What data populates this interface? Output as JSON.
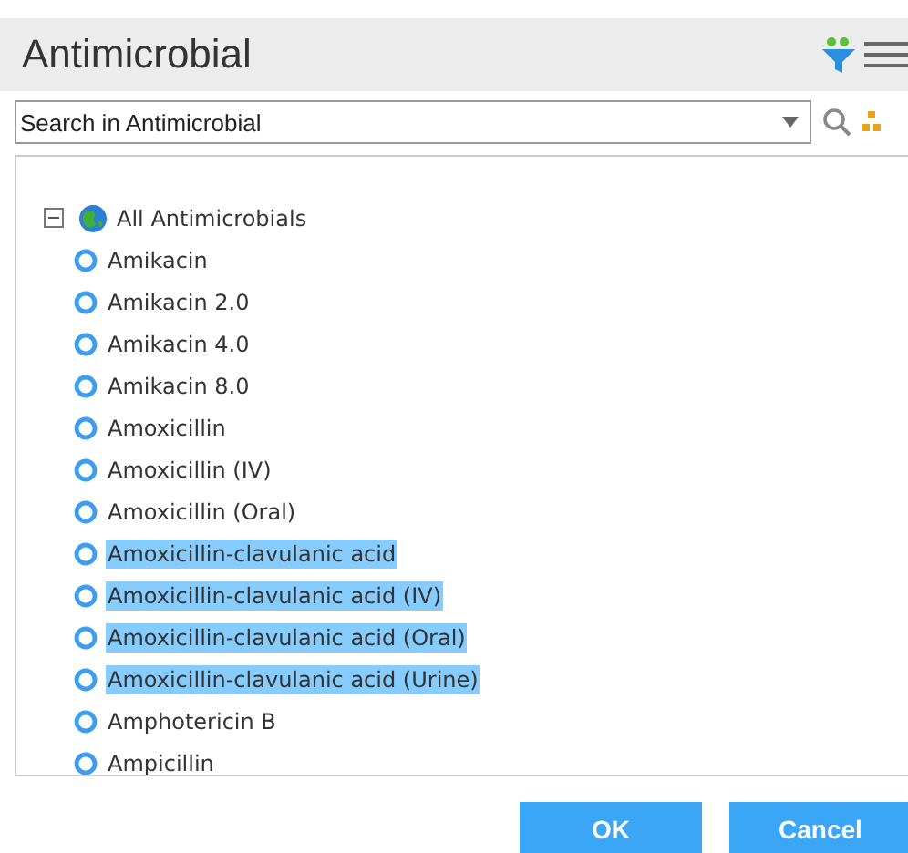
{
  "header": {
    "title": "Antimicrobial"
  },
  "search": {
    "placeholder": "Search in Antimicrobial"
  },
  "tree": {
    "label": "All Antimicrobials",
    "expanded": true,
    "children": [
      {
        "label": "Amikacin",
        "selected": false
      },
      {
        "label": "Amikacin 2.0",
        "selected": false
      },
      {
        "label": "Amikacin 4.0",
        "selected": false
      },
      {
        "label": "Amikacin 8.0",
        "selected": false
      },
      {
        "label": "Amoxicillin",
        "selected": false
      },
      {
        "label": "Amoxicillin (IV)",
        "selected": false
      },
      {
        "label": "Amoxicillin (Oral)",
        "selected": false
      },
      {
        "label": "Amoxicillin-clavulanic acid",
        "selected": true
      },
      {
        "label": "Amoxicillin-clavulanic acid (IV)",
        "selected": true
      },
      {
        "label": "Amoxicillin-clavulanic acid (Oral)",
        "selected": true
      },
      {
        "label": "Amoxicillin-clavulanic acid (Urine)",
        "selected": true
      },
      {
        "label": "Amphotericin B",
        "selected": false
      },
      {
        "label": "Ampicillin",
        "selected": false
      }
    ]
  },
  "buttons": [
    "OK",
    "Cancel"
  ]
}
